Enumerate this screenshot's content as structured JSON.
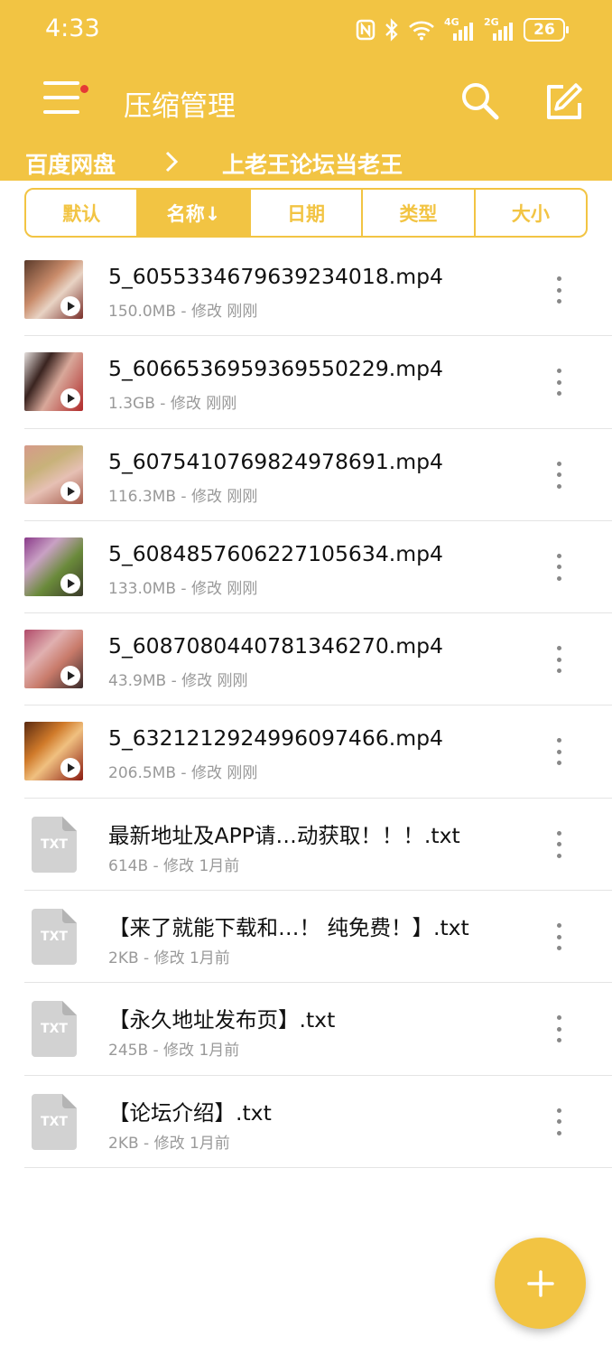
{
  "status_bar": {
    "time": "4:33",
    "network_1": "4G",
    "network_2": "2G",
    "battery": "26"
  },
  "app_bar": {
    "title": "压缩管理",
    "menu_icon": "hamburger-menu-icon",
    "search_icon": "search-icon",
    "edit_icon": "edit-icon"
  },
  "breadcrumb": {
    "root": "百度网盘",
    "current": "上老王论坛当老王"
  },
  "sort_tabs": [
    {
      "label": "默认",
      "active": false
    },
    {
      "label": "名称↓",
      "active": true
    },
    {
      "label": "日期",
      "active": false
    },
    {
      "label": "类型",
      "active": false
    },
    {
      "label": "大小",
      "active": false
    }
  ],
  "files": [
    {
      "name": "5_6055334679639234018.mp4",
      "meta": "150.0MB - 修改 刚刚",
      "type": "video"
    },
    {
      "name": "5_6066536959369550229.mp4",
      "meta": "1.3GB - 修改 刚刚",
      "type": "video"
    },
    {
      "name": "5_6075410769824978691.mp4",
      "meta": "116.3MB - 修改 刚刚",
      "type": "video"
    },
    {
      "name": "5_6084857606227105634.mp4",
      "meta": "133.0MB - 修改 刚刚",
      "type": "video"
    },
    {
      "name": "5_6087080440781346270.mp4",
      "meta": "43.9MB - 修改 刚刚",
      "type": "video"
    },
    {
      "name": "5_6321212924996097466.mp4",
      "meta": "206.5MB - 修改 刚刚",
      "type": "video"
    },
    {
      "name": "最新地址及APP请…动获取！！！.txt",
      "meta": "614B - 修改 1月前",
      "type": "txt"
    },
    {
      "name": "【来了就能下载和…！ 纯免费！】.txt",
      "meta": "2KB - 修改 1月前",
      "type": "txt"
    },
    {
      "name": "【永久地址发布页】.txt",
      "meta": "245B - 修改 1月前",
      "type": "txt"
    },
    {
      "name": "【论坛介绍】.txt",
      "meta": "2KB - 修改 1月前",
      "type": "txt"
    }
  ],
  "txt_label": "TXT",
  "colors": {
    "accent": "#F2C443",
    "notification_dot": "#E53935",
    "meta_text": "#999999"
  },
  "fab_icon": "plus-icon"
}
